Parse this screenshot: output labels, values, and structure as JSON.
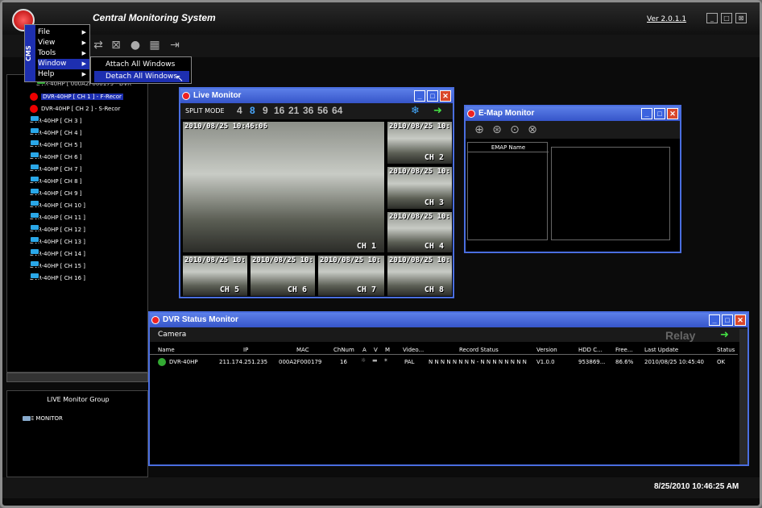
{
  "app": {
    "title": "Central Monitoring System",
    "version": "Ver 2.0.1.1",
    "min": "_",
    "max": "□",
    "close": "⊠"
  },
  "menu": {
    "side_label": "CMS",
    "items": [
      {
        "label": "File"
      },
      {
        "label": "View"
      },
      {
        "label": "Tools"
      },
      {
        "label": "Window"
      },
      {
        "label": "Help"
      }
    ],
    "window_sub": [
      {
        "label": "Attach All Windows"
      },
      {
        "label": "Detach All Windows"
      }
    ]
  },
  "tree": {
    "root": "DVR-40HP [ 000A2F000179 - DVR",
    "items": [
      {
        "label": "DVR-40HP [ CH 1 ] - F-Recor",
        "icon": "record-icon"
      },
      {
        "label": "DVR-40HP [ CH 2 ] - S-Recor",
        "icon": "record-icon"
      },
      {
        "label": "DVR-40HP [ CH 3 ]",
        "icon": "camera-icon"
      },
      {
        "label": "DVR-40HP [ CH 4 ]",
        "icon": "camera-icon"
      },
      {
        "label": "DVR-40HP [ CH 5 ]",
        "icon": "camera-icon"
      },
      {
        "label": "DVR-40HP [ CH 6 ]",
        "icon": "camera-icon"
      },
      {
        "label": "DVR-40HP [ CH 7 ]",
        "icon": "camera-icon"
      },
      {
        "label": "DVR-40HP [ CH 8 ]",
        "icon": "camera-icon"
      },
      {
        "label": "DVR-40HP [ CH 9 ]",
        "icon": "camera-icon"
      },
      {
        "label": "DVR-40HP [ CH 10 ]",
        "icon": "camera-icon"
      },
      {
        "label": "DVR-40HP [ CH 11 ]",
        "icon": "camera-icon"
      },
      {
        "label": "DVR-40HP [ CH 12 ]",
        "icon": "camera-icon"
      },
      {
        "label": "DVR-40HP [ CH 13 ]",
        "icon": "camera-icon"
      },
      {
        "label": "DVR-40HP [ CH 14 ]",
        "icon": "camera-icon"
      },
      {
        "label": "DVR-40HP [ CH 15 ]",
        "icon": "camera-icon"
      },
      {
        "label": "DVR-40HP [ CH 16 ]",
        "icon": "camera-icon"
      }
    ]
  },
  "group": {
    "title": "LIVE Monitor Group",
    "item": "LIVE MONITOR"
  },
  "live": {
    "title": "Live Monitor",
    "split_label": "SPLIT MODE",
    "split_modes": [
      "4",
      "8",
      "9",
      "16",
      "21",
      "36",
      "56",
      "64"
    ],
    "active_mode": "8",
    "cams": [
      {
        "ts": "2010/08/25 10:46:06",
        "ch": "CH 1"
      },
      {
        "ts": "2010/08/25 10:",
        "ch": "CH 2"
      },
      {
        "ts": "2010/08/25 10:",
        "ch": "CH 3"
      },
      {
        "ts": "2010/08/25 10:",
        "ch": "CH 4"
      },
      {
        "ts": "2010/08/25 10:",
        "ch": "CH 5"
      },
      {
        "ts": "2010/08/25 10:",
        "ch": "CH 6"
      },
      {
        "ts": "2010/08/25 10:",
        "ch": "CH 7"
      },
      {
        "ts": "2010/08/25 10:",
        "ch": "CH 8"
      }
    ]
  },
  "emap": {
    "title": "E-Map Monitor",
    "col_header": "EMAP Name"
  },
  "dvr": {
    "title": "DVR Status Monitor",
    "tab": "Camera",
    "relay": "Relay",
    "headers": [
      "Name",
      "IP",
      "MAC",
      "ChNum",
      "A",
      "V",
      "M",
      "Video...",
      "Record Status",
      "Version",
      "HDD C...",
      "Free...",
      "Last Update",
      "Status"
    ],
    "row": {
      "name": "DVR-40HP",
      "ip": "211.174.251.235",
      "mac": "000A2F000179",
      "chnum": "16",
      "video": "PAL",
      "record": "N N N N N N N N - N N N N N N N N",
      "version": "V1.0.0",
      "hdd": "953869...",
      "free": "86.6%",
      "last": "2010/08/25 10:45:40",
      "status": "OK"
    }
  },
  "status": {
    "clock": "8/25/2010 10:46:25 AM"
  }
}
